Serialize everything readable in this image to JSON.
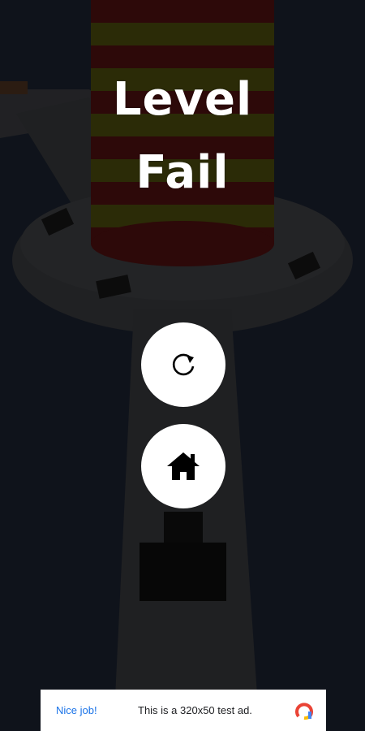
{
  "screen": {
    "title_line1": "Level",
    "title_line2": "Fail"
  },
  "buttons": {
    "restart_icon": "restart-icon",
    "home_icon": "home-icon"
  },
  "ad": {
    "cta_label": "Nice job!",
    "text": "This is a 320x50 test ad.",
    "logo_icon": "adchoices-icon"
  },
  "colors": {
    "overlay": "#000000",
    "button_bg": "#ffffff",
    "ad_link": "#1a73e8",
    "tower_red": "#8a1a1a",
    "tower_yellow": "#7a7a10"
  }
}
